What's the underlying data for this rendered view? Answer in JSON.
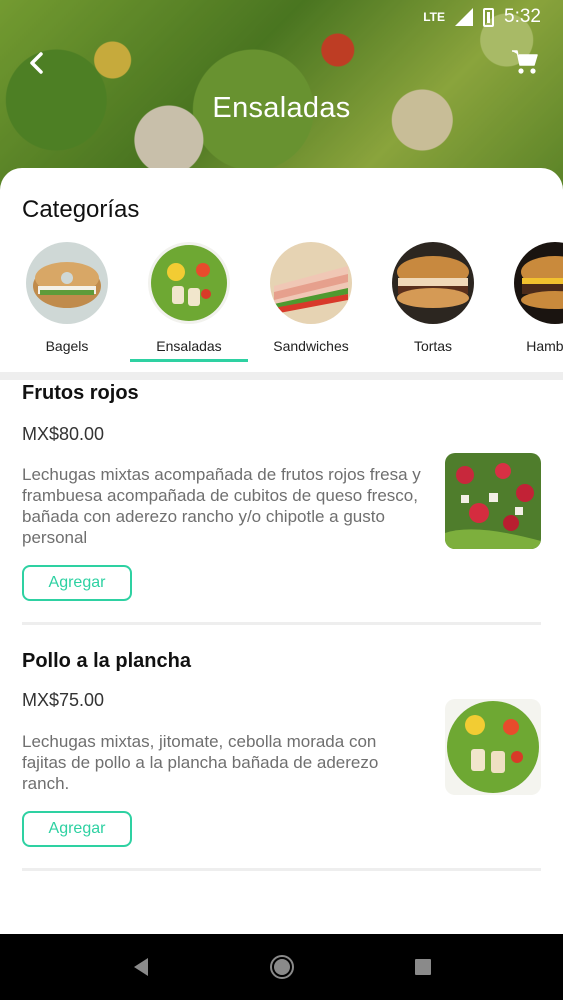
{
  "status": {
    "network": "LTE",
    "time": "5:32"
  },
  "header": {
    "title": "Ensaladas",
    "back_icon": "back-icon",
    "cart_icon": "cart-icon"
  },
  "categories": {
    "title": "Categorías",
    "items": [
      {
        "label": "Bagels",
        "selected": false
      },
      {
        "label": "Ensaladas",
        "selected": true
      },
      {
        "label": "Sandwiches",
        "selected": false
      },
      {
        "label": "Tortas",
        "selected": false
      },
      {
        "label": "Hamburg",
        "selected": false
      }
    ]
  },
  "menu": {
    "items": [
      {
        "name": "Frutos rojos",
        "price": "MX$80.00",
        "description": "Lechugas mixtas acompañada de frutos rojos fresa y frambuesa acompañada de cubitos de queso fresco, bañada con aderezo rancho y/o chipotle a gusto personal",
        "button": "Agregar"
      },
      {
        "name": "Pollo a la plancha",
        "price": "MX$75.00",
        "description": "Lechugas mixtas, jitomate, cebolla morada con fajitas de pollo a la plancha bañada de aderezo ranch.",
        "button": "Agregar"
      }
    ]
  },
  "colors": {
    "accent": "#2ed1a2",
    "nav_bar": "#000000"
  },
  "navbar": {
    "back": "nav-back-icon",
    "home": "nav-home-icon",
    "recents": "nav-recents-icon"
  }
}
